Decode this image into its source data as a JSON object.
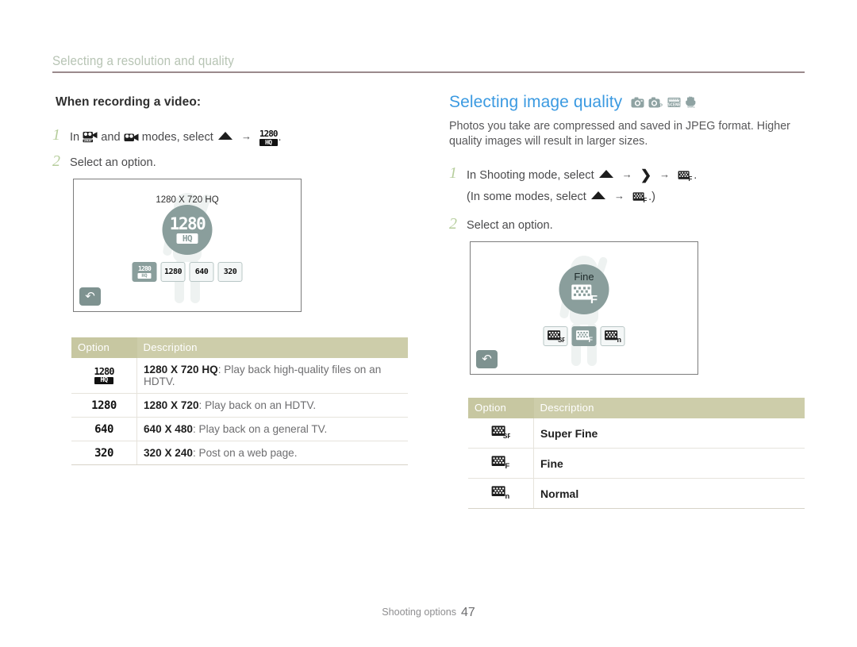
{
  "header": {
    "running_title": "Selecting a resolution and quality"
  },
  "left": {
    "subhead": "When recording a video:",
    "steps": [
      {
        "num": "1",
        "text_before": "In",
        "text_mid": "and",
        "text_after": "modes, select",
        "icon_a": "smart-movie-mode-icon",
        "icon_b": "movie-mode-icon",
        "icon_up": "up-arrow-icon",
        "icon_target": "1280hq-badge-icon",
        "period": "."
      },
      {
        "num": "2",
        "text": "Select an option."
      }
    ],
    "screen": {
      "caption": "1280 X 720 HQ",
      "selected_top": "1280",
      "selected_bottom": "HQ",
      "options": [
        "1280 HQ",
        "1280",
        "640",
        "320"
      ],
      "back_button": "back-icon"
    },
    "table": {
      "headers": [
        "Option",
        "Description"
      ],
      "rows": [
        {
          "icon": "1280hq-badge-icon",
          "bold": "1280 X 720 HQ",
          "rest": ": Play back high-quality files on an HDTV."
        },
        {
          "icon": "1280-badge-icon",
          "bold": "1280 X 720",
          "rest": ": Play back on an HDTV."
        },
        {
          "icon": "640-badge-icon",
          "bold": "640 X 480",
          "rest": ": Play back on a general TV."
        },
        {
          "icon": "320-badge-icon",
          "bold": "320 X 240",
          "rest": ": Post on a web page."
        }
      ]
    }
  },
  "right": {
    "title": "Selecting image quality",
    "mode_icons": [
      "auto-camera-mode-icon",
      "program-mode-icon",
      "scene-mode-icon",
      "dual-is-mode-icon"
    ],
    "lede": "Photos you take are compressed and saved in JPEG format. Higher quality images will result in larger sizes.",
    "steps": [
      {
        "num": "1",
        "line1_before": "In Shooting mode, select",
        "line1_after": ".",
        "line2_before": "(In some modes, select",
        "line2_after": ".)"
      },
      {
        "num": "2",
        "text": "Select an option."
      }
    ],
    "screen": {
      "caption": "Fine",
      "options": [
        "Super Fine",
        "Fine",
        "Normal"
      ],
      "selected": "Fine",
      "back_button": "back-icon"
    },
    "table": {
      "headers": [
        "Option",
        "Description"
      ],
      "rows": [
        {
          "icon": "super-fine-quality-icon",
          "label": "Super Fine"
        },
        {
          "icon": "fine-quality-icon",
          "label": "Fine"
        },
        {
          "icon": "normal-quality-icon",
          "label": "Normal"
        }
      ]
    }
  },
  "footer": {
    "section": "Shooting options",
    "page": "47"
  },
  "colors": {
    "accent_blue": "#3b9ae1",
    "table_header": "#cdcdaa",
    "step_number": "#b7ce9d",
    "screen_chip": "#8a9e9c",
    "rule": "#9a8a8c"
  }
}
